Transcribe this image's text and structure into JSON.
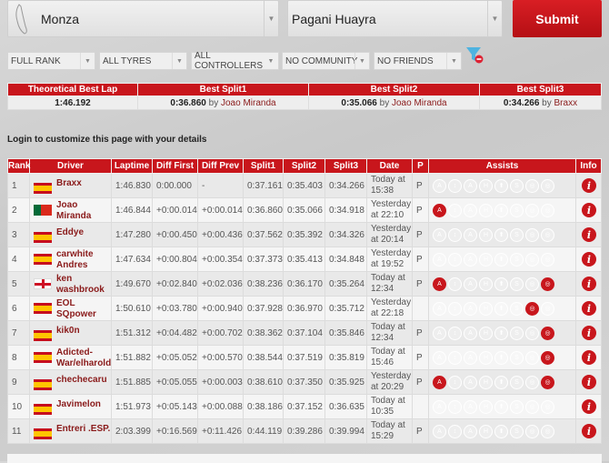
{
  "track": {
    "value": "Monza"
  },
  "car": {
    "value": "Pagani Huayra"
  },
  "submit_label": "Submit",
  "filters": [
    "FULL RANK",
    "ALL TYRES",
    "ALL CONTROLLERS",
    "NO COMMUNITY",
    "NO FRIENDS"
  ],
  "best": {
    "headers": [
      "Theoretical Best Lap",
      "Best Split1",
      "Best Split2",
      "Best Split3"
    ],
    "theoretical": "1:46.192",
    "splits": [
      {
        "time": "0:36.860",
        "by": "by",
        "driver": "Joao Miranda"
      },
      {
        "time": "0:35.066",
        "by": "by",
        "driver": "Joao Miranda"
      },
      {
        "time": "0:34.266",
        "by": "by",
        "driver": "Braxx"
      }
    ]
  },
  "login_text": "Login to customize this page with your details",
  "columns": [
    "Rank",
    "Driver",
    "Laptime",
    "Diff First",
    "Diff Prev",
    "Split1",
    "Split2",
    "Split3",
    "Date",
    "P",
    "Assists",
    "Info"
  ],
  "assist_icons": [
    "abs-icon",
    "traction-icon",
    "stability-icon",
    "gearbox-icon",
    "clutch-icon",
    "racing-line-icon",
    "brake-icon",
    "damage-icon"
  ],
  "accent": "#c8161c",
  "rows": [
    {
      "rank": "1",
      "flag": "es",
      "driver": "Braxx",
      "lap": "1:46.830",
      "df": "0:00.000",
      "dp": "-",
      "s1": "0:37.161",
      "s2": "0:35.403",
      "s3": "0:34.266",
      "date": "Today at 15:38",
      "p": "P",
      "assists": []
    },
    {
      "rank": "2",
      "flag": "pt",
      "driver": "Joao Miranda",
      "lap": "1:46.844",
      "df": "+0:00.014",
      "dp": "+0:00.014",
      "s1": "0:36.860",
      "s2": "0:35.066",
      "s3": "0:34.918",
      "date": "Yesterday at 22:10",
      "p": "P",
      "assists": [
        0
      ]
    },
    {
      "rank": "3",
      "flag": "es",
      "driver": "Eddye",
      "lap": "1:47.280",
      "df": "+0:00.450",
      "dp": "+0:00.436",
      "s1": "0:37.562",
      "s2": "0:35.392",
      "s3": "0:34.326",
      "date": "Yesterday at 20:14",
      "p": "P",
      "assists": []
    },
    {
      "rank": "4",
      "flag": "es",
      "driver": "carwhite Andres",
      "lap": "1:47.634",
      "df": "+0:00.804",
      "dp": "+0:00.354",
      "s1": "0:37.373",
      "s2": "0:35.413",
      "s3": "0:34.848",
      "date": "Yesterday at 19:52",
      "p": "P",
      "assists": []
    },
    {
      "rank": "5",
      "flag": "en",
      "driver": "ken washbrook",
      "lap": "1:49.670",
      "df": "+0:02.840",
      "dp": "+0:02.036",
      "s1": "0:38.236",
      "s2": "0:36.170",
      "s3": "0:35.264",
      "date": "Today at 12:34",
      "p": "P",
      "assists": [
        0,
        7
      ]
    },
    {
      "rank": "6",
      "flag": "es",
      "driver": "EOL SQpower",
      "lap": "1:50.610",
      "df": "+0:03.780",
      "dp": "+0:00.940",
      "s1": "0:37.928",
      "s2": "0:36.970",
      "s3": "0:35.712",
      "date": "Yesterday at 22:18",
      "p": "",
      "assists": [
        6
      ]
    },
    {
      "rank": "7",
      "flag": "es",
      "driver": "kik0n",
      "lap": "1:51.312",
      "df": "+0:04.482",
      "dp": "+0:00.702",
      "s1": "0:38.362",
      "s2": "0:37.104",
      "s3": "0:35.846",
      "date": "Today at 12:34",
      "p": "P",
      "assists": [
        7
      ]
    },
    {
      "rank": "8",
      "flag": "es",
      "driver": "Adicted-War/elharold",
      "lap": "1:51.882",
      "df": "+0:05.052",
      "dp": "+0:00.570",
      "s1": "0:38.544",
      "s2": "0:37.519",
      "s3": "0:35.819",
      "date": "Today at 15:46",
      "p": "P",
      "assists": [
        7
      ]
    },
    {
      "rank": "9",
      "flag": "es",
      "driver": "chechecaru",
      "lap": "1:51.885",
      "df": "+0:05.055",
      "dp": "+0:00.003",
      "s1": "0:38.610",
      "s2": "0:37.350",
      "s3": "0:35.925",
      "date": "Yesterday at 20:29",
      "p": "P",
      "assists": [
        0,
        7
      ]
    },
    {
      "rank": "10",
      "flag": "es",
      "driver": "Javimelon",
      "lap": "1:51.973",
      "df": "+0:05.143",
      "dp": "+0:00.088",
      "s1": "0:38.186",
      "s2": "0:37.152",
      "s3": "0:36.635",
      "date": "Today at 10:35",
      "p": "",
      "assists": []
    },
    {
      "rank": "11",
      "flag": "es",
      "driver": "Entreri .ESP.",
      "lap": "2:03.399",
      "df": "+0:16.569",
      "dp": "+0:11.426",
      "s1": "0:44.119",
      "s2": "0:39.286",
      "s3": "0:39.994",
      "date": "Today at 15:29",
      "p": "P",
      "assists": []
    }
  ]
}
